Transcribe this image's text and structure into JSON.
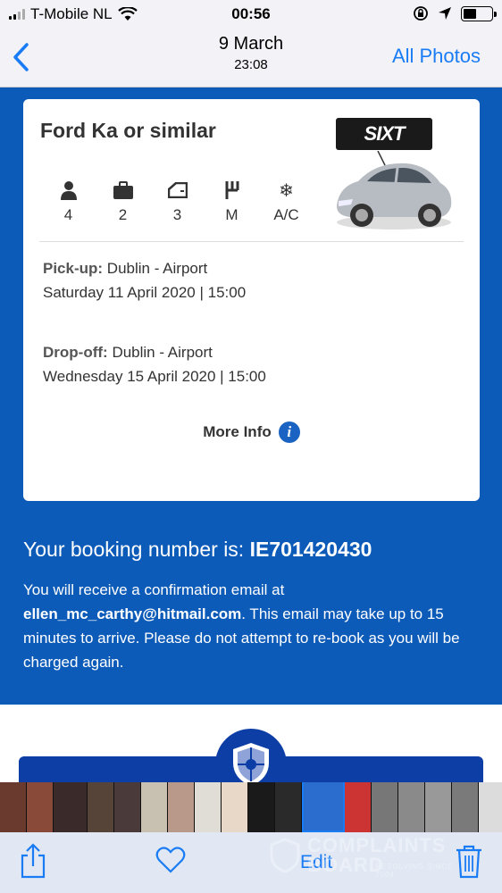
{
  "status_bar": {
    "carrier": "T-Mobile NL",
    "time": "00:56"
  },
  "nav": {
    "back_icon": "chevron-left-icon",
    "date": "9 March",
    "time": "23:08",
    "all_photos": "All Photos"
  },
  "card": {
    "car_name": "Ford Ka or similar",
    "brand_logo": "SIXT",
    "specs": [
      {
        "icon": "person-icon",
        "value": "4"
      },
      {
        "icon": "suitcase-icon",
        "value": "2"
      },
      {
        "icon": "door-icon",
        "value": "3"
      },
      {
        "icon": "gearshift-icon",
        "value": "M"
      },
      {
        "icon": "snowflake-icon",
        "value": "A/C"
      }
    ],
    "pickup": {
      "label": "Pick-up:",
      "location": "Dublin - Airport",
      "datetime": "Saturday 11 April 2020 | 15:00"
    },
    "dropoff": {
      "label": "Drop-off:",
      "location": "Dublin - Airport",
      "datetime": "Wednesday 15 April 2020 | 15:00"
    },
    "more_info": "More Info"
  },
  "booking": {
    "prefix": "Your booking number is:",
    "number": "IE701420430"
  },
  "confirmation": {
    "lead": "You will receive a confirmation email at",
    "email": "ellen_mc_carthy@hitmail.com",
    "tail": ". This email may take up to 15 minutes to arrive. Please do not attempt to re-book as you will be charged again."
  },
  "toolbar": {
    "edit_label": "Edit",
    "share_icon": "share-icon",
    "heart_icon": "heart-icon",
    "trash_icon": "trash-icon"
  },
  "watermark": {
    "line1": "COMPLAINTS",
    "line2": "BOARD",
    "sub": "RESOLVING SINCE 2004"
  },
  "colors": {
    "brand_blue": "#0d5bb8",
    "ios_blue": "#1a7cf5",
    "banner_navy": "#0d3ea6"
  }
}
